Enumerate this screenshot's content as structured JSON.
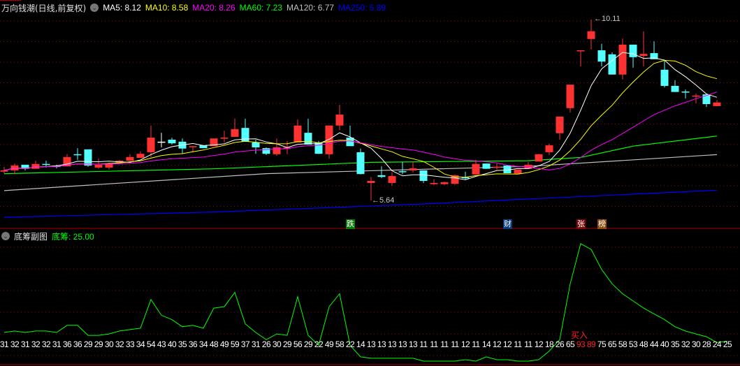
{
  "header": {
    "title": "万向钱潮(日线,前复权)",
    "ma": [
      {
        "label": "MA5: 8.12",
        "color": "#ffffff",
        "period": 5
      },
      {
        "label": "MA10: 8.58",
        "color": "#ffff00",
        "period": 10
      },
      {
        "label": "MA20: 8.26",
        "color": "#ff00ff",
        "period": 20
      },
      {
        "label": "MA60: 7.23",
        "color": "#00ff00"
      },
      {
        "label": "MA120: 6.77",
        "color": "#c0c0c0"
      },
      {
        "label": "MA250: 5.89",
        "color": "#0000ff"
      }
    ]
  },
  "sub_header": {
    "title": "底筹副图",
    "value_label": "底筹: 25.00"
  },
  "annotations": {
    "high": "10.11",
    "low": "5.64",
    "buy": "买入"
  },
  "markers": [
    {
      "text": "跌",
      "bg": "#0a7a0a",
      "index": 33
    },
    {
      "text": "财",
      "bg": "#0a3a78",
      "index": 48
    },
    {
      "text": "张",
      "bg": "#7a0a0a",
      "index": 55
    },
    {
      "text": "榜",
      "bg": "#8a4a10",
      "index": 57
    }
  ],
  "colors": {
    "up": "#ff3232",
    "down": "#54ffff",
    "grid": "#7a1010",
    "divider": "#b00000",
    "sub_line": "#00ff00"
  },
  "chart_data": {
    "type": "candlestick",
    "price_range": [
      5.64,
      10.11
    ],
    "candles": [
      [
        6.35,
        6.47,
        6.31,
        6.38
      ],
      [
        6.38,
        6.55,
        6.28,
        6.5
      ],
      [
        6.52,
        6.52,
        6.38,
        6.42
      ],
      [
        6.42,
        6.62,
        6.42,
        6.54
      ],
      [
        6.54,
        6.62,
        6.45,
        6.53
      ],
      [
        6.49,
        6.52,
        6.43,
        6.48
      ],
      [
        6.48,
        6.78,
        6.48,
        6.71
      ],
      [
        6.78,
        6.93,
        6.64,
        6.77
      ],
      [
        6.9,
        6.9,
        6.47,
        6.5
      ],
      [
        6.45,
        6.67,
        6.42,
        6.52
      ],
      [
        6.45,
        6.57,
        6.4,
        6.55
      ],
      [
        6.57,
        6.64,
        6.57,
        6.62
      ],
      [
        6.62,
        6.78,
        6.62,
        6.71
      ],
      [
        6.69,
        6.85,
        6.69,
        6.79
      ],
      [
        6.83,
        7.49,
        6.71,
        7.19
      ],
      [
        7.09,
        7.31,
        6.95,
        7.09
      ],
      [
        7.14,
        7.19,
        7.02,
        7.05
      ],
      [
        7.09,
        7.17,
        6.79,
        6.92
      ],
      [
        6.97,
        6.98,
        6.83,
        6.98
      ],
      [
        7.0,
        7.0,
        6.93,
        6.93
      ],
      [
        6.98,
        7.17,
        6.98,
        7.17
      ],
      [
        7.18,
        7.36,
        7.07,
        7.19
      ],
      [
        7.21,
        7.66,
        7.21,
        7.4
      ],
      [
        7.43,
        7.66,
        7.09,
        7.09
      ],
      [
        7.07,
        7.14,
        6.79,
        6.95
      ],
      [
        6.93,
        6.95,
        6.76,
        6.79
      ],
      [
        6.78,
        7.17,
        6.74,
        6.95
      ],
      [
        6.92,
        7.11,
        6.78,
        6.95
      ],
      [
        7.07,
        7.64,
        7.07,
        7.49
      ],
      [
        7.31,
        7.66,
        7.02,
        7.02
      ],
      [
        7.07,
        7.11,
        6.79,
        6.79
      ],
      [
        6.78,
        7.49,
        6.67,
        7.49
      ],
      [
        7.49,
        8.0,
        7.38,
        7.76
      ],
      [
        7.19,
        7.49,
        6.98,
        6.98
      ],
      [
        6.83,
        6.92,
        6.28,
        6.29
      ],
      [
        6.07,
        6.22,
        5.64,
        6.12
      ],
      [
        6.26,
        6.48,
        6.19,
        6.22
      ],
      [
        6.07,
        6.33,
        6.0,
        6.24
      ],
      [
        6.36,
        6.59,
        6.28,
        6.35
      ],
      [
        6.38,
        6.59,
        6.33,
        6.43
      ],
      [
        6.38,
        6.38,
        6.07,
        6.12
      ],
      [
        6.04,
        6.16,
        6.02,
        6.07
      ],
      [
        6.04,
        6.1,
        6.02,
        6.09
      ],
      [
        6.05,
        6.28,
        6.02,
        6.26
      ],
      [
        6.21,
        6.35,
        6.16,
        6.2
      ],
      [
        6.28,
        6.64,
        6.28,
        6.54
      ],
      [
        6.55,
        6.55,
        6.42,
        6.42
      ],
      [
        6.46,
        6.55,
        6.4,
        6.47
      ],
      [
        6.5,
        6.5,
        6.31,
        6.31
      ],
      [
        6.3,
        6.4,
        6.3,
        6.4
      ],
      [
        6.42,
        6.59,
        6.42,
        6.52
      ],
      [
        6.6,
        6.79,
        6.6,
        6.78
      ],
      [
        6.83,
        7.04,
        6.76,
        7.0
      ],
      [
        7.3,
        7.71,
        7.14,
        7.71
      ],
      [
        7.92,
        8.5,
        7.81,
        8.5
      ],
      [
        9.35,
        9.35,
        8.95,
        9.35
      ],
      [
        9.63,
        10.11,
        9.37,
        9.82
      ],
      [
        9.35,
        9.51,
        8.95,
        9.07
      ],
      [
        9.25,
        9.3,
        8.75,
        8.75
      ],
      [
        8.75,
        9.64,
        8.63,
        9.49
      ],
      [
        9.49,
        9.49,
        8.92,
        9.18
      ],
      [
        9.21,
        9.82,
        8.95,
        9.26
      ],
      [
        9.28,
        9.57,
        9.13,
        9.13
      ],
      [
        8.87,
        9.11,
        8.43,
        8.47
      ],
      [
        8.47,
        8.61,
        8.32,
        8.32
      ],
      [
        8.33,
        8.38,
        8.16,
        8.31
      ],
      [
        8.21,
        8.28,
        8.04,
        8.23
      ],
      [
        8.26,
        8.26,
        7.95,
        8.02
      ],
      [
        7.97,
        8.12,
        7.97,
        8.06
      ]
    ],
    "ma_long": {
      "MA60": [
        [
          0,
          6.3
        ],
        [
          20,
          6.42
        ],
        [
          35,
          6.58
        ],
        [
          50,
          6.62
        ],
        [
          55,
          6.7
        ],
        [
          60,
          6.98
        ],
        [
          68,
          7.23
        ]
      ],
      "MA120": [
        [
          0,
          5.88
        ],
        [
          25,
          6.3
        ],
        [
          50,
          6.48
        ],
        [
          68,
          6.77
        ]
      ],
      "MA250": [
        [
          0,
          5.22
        ],
        [
          20,
          5.35
        ],
        [
          40,
          5.55
        ],
        [
          68,
          5.89
        ]
      ]
    },
    "sub_values": [
      31,
      32,
      31,
      32,
      32,
      31,
      36,
      36,
      29,
      29,
      30,
      32,
      33,
      34,
      54,
      43,
      40,
      35,
      36,
      34,
      48,
      49,
      59,
      37,
      31,
      26,
      30,
      29,
      56,
      29,
      22,
      49,
      58,
      22,
      14,
      13,
      13,
      13,
      13,
      13,
      11,
      11,
      11,
      11,
      12,
      11,
      14,
      12,
      12,
      11,
      11,
      12,
      18,
      26,
      65,
      93,
      89,
      75,
      65,
      58,
      53,
      48,
      44,
      40,
      35,
      32,
      30,
      28,
      24,
      25
    ],
    "sub_highlight": [
      55,
      56
    ],
    "sub_range": [
      11,
      93
    ]
  }
}
